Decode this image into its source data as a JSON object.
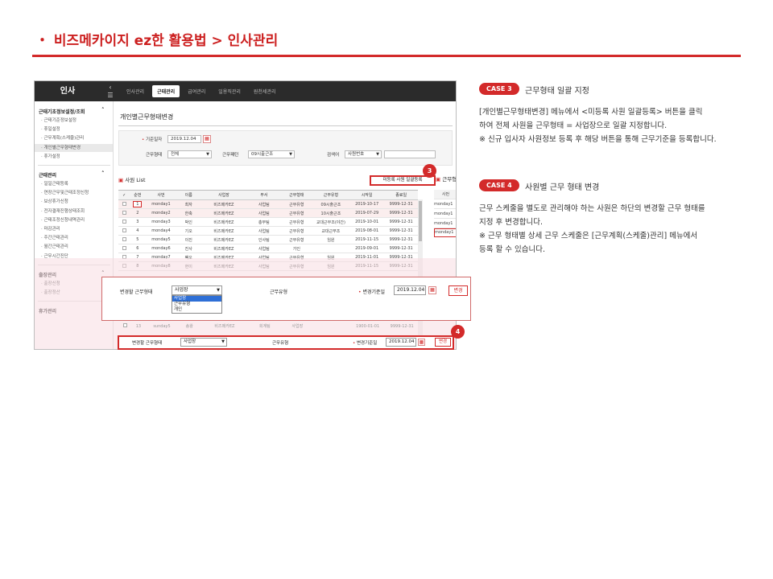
{
  "page": {
    "title": "・ 비즈메카이지 ez한 활용법 > 인사관리"
  },
  "app": {
    "brand": "인사",
    "top_nav": [
      "인사관리",
      "근태관리",
      "급여관리",
      "일용직관리",
      "원천세관리"
    ],
    "active_nav_index": 1,
    "sidebar": {
      "sections": [
        {
          "title": "근태기초정보설정/조회",
          "items": [
            "근태기준정보설정",
            "휴일설정",
            "근무계획(스케줄)관리",
            "개인별근무형태변경",
            "휴가설정"
          ],
          "selected_index": 3
        },
        {
          "title": "근태관리",
          "items": [
            "일일근태등록",
            "연장근무및근태조정신청",
            "보상휴가신청",
            "전자결재진행상태조회",
            "근태조정신청내역관리",
            "마감관리",
            "주간근태관리",
            "월간근태관리",
            "근무시간진단"
          ]
        },
        {
          "title": "출장관리",
          "items": [
            "출장신청",
            "출장정산"
          ]
        },
        {
          "title": "휴가관리",
          "items": []
        }
      ]
    },
    "main": {
      "title": "개인별근무형태변경",
      "filters": {
        "base_date_label": "기준일자",
        "base_date_value": "2019.12.04",
        "work_type_label": "근무형태",
        "work_type_value": "전체",
        "work_pattern_label": "근무패턴",
        "work_pattern_value": "09시출근조",
        "search_label": "검색어",
        "search_field_value": "사원번호",
        "search_input_value": ""
      },
      "list_label": "사원 List",
      "bulk_button_label": "미등록 사원 일괄등록",
      "right_panel_label": "근무형",
      "table": {
        "headers": [
          "✓",
          "순번",
          "사번",
          "이름",
          "사업장",
          "부서",
          "근무형태",
          "근무유형",
          "시작일",
          "종료일"
        ],
        "rows": [
          [
            "",
            "1",
            "monday1",
            "최자",
            "비즈메카EZ",
            "사업팀",
            "근무유형",
            "09시출근조",
            "2019-10-17",
            "9999-12-31"
          ],
          [
            "",
            "2",
            "monday2",
            "한축",
            "비즈메카EZ",
            "사업팀",
            "근무유형",
            "10시출근조",
            "2019-07-29",
            "9999-12-31"
          ],
          [
            "",
            "3",
            "monday3",
            "박인",
            "비즈메카EZ",
            "총무팀",
            "근무유형",
            "교대근무조(야간)",
            "2019-10-01",
            "9999-12-31"
          ],
          [
            "",
            "4",
            "monday4",
            "기오",
            "비즈메카EZ",
            "사업팀",
            "근무유형",
            "교대근무조",
            "2019-08-01",
            "9999-12-31"
          ],
          [
            "",
            "5",
            "monday5",
            "이진",
            "비즈메카EZ",
            "인사팀",
            "근무유형",
            "임원",
            "2019-11-15",
            "9999-12-31"
          ],
          [
            "",
            "6",
            "monday6",
            "진사",
            "비즈메카EZ",
            "사업팀",
            "가인",
            "",
            "2019-09-01",
            "9999-12-31"
          ],
          [
            "",
            "7",
            "monday7",
            "팩오",
            "비즈메카EZ",
            "사업팀",
            "근무유형",
            "임원",
            "2019-11-01",
            "9999-12-31"
          ],
          [
            "",
            "8",
            "monday8",
            "현이",
            "비즈메카EZ",
            "사업팀",
            "근무유형",
            "임원",
            "2019-11-15",
            "9999-12-31"
          ]
        ],
        "highlight_rows": [
          0,
          1
        ]
      },
      "overlay_row": [
        "",
        "13",
        "sunday5",
        "송왕",
        "비즈메카EZ",
        "회계팀",
        "사업장",
        "",
        "1900-01-01",
        "9999-12-31"
      ],
      "right_table": {
        "header": "사번",
        "rows": [
          "monday1",
          "monday1",
          "monday1",
          "monday1"
        ]
      }
    }
  },
  "zoom_panel": {
    "change_type_label": "변경할 근무형태",
    "change_type_value": "사업장",
    "dropdown_options": [
      "사업장",
      "근무유형",
      "개인"
    ],
    "dropdown_selected_index": 0,
    "work_kind_label": "근무유형",
    "change_base_date_label": "변경기준일",
    "change_base_date_value": "2019.12.04",
    "change_button": "변경"
  },
  "bottom_bar": {
    "change_type_label": "변경할 근무형태",
    "change_type_value": "사업장",
    "work_kind_label": "근무유형",
    "change_base_date_label": "변경기준일",
    "change_base_date_value": "2019.12.04",
    "change_button": "변경"
  },
  "markers": {
    "marker3": "3",
    "marker4": "4"
  },
  "cases": [
    {
      "badge": "CASE 3",
      "title": "근무형태 일괄 지정",
      "lines": [
        "[개인별근무형태변경] 메뉴에서 <미등록 사원 일괄등록> 버튼을 클릭",
        "하여 전체 사원을 근무형태 = 사업장으로 일괄 지정합니다.",
        "※ 신규 입사자 사원정보 등록 후 해당 버튼을 통해 근무기준을 등록합니다."
      ]
    },
    {
      "badge": "CASE 4",
      "title": "사원별 근무 형태 변경",
      "lines": [
        "근무 스케줄을 별도로 관리해야 하는 사원은 하단의 변경할 근무 형태를",
        "지정 후 변경합니다.",
        "※ 근무 형태별 상세 근무 스케줄은 [근무계획(스케줄)관리] 메뉴에서",
        "등록 할 수 있습니다."
      ]
    }
  ],
  "colors": {
    "accent": "#d32a2a",
    "topbar": "#2b2b2b",
    "highlight_row": "#fbeeee"
  },
  "icons": {
    "menu": "hamburger-icon",
    "calendar": "calendar-icon",
    "dropdown": "chevron-down-icon",
    "collapse": "chevron-up-icon"
  }
}
